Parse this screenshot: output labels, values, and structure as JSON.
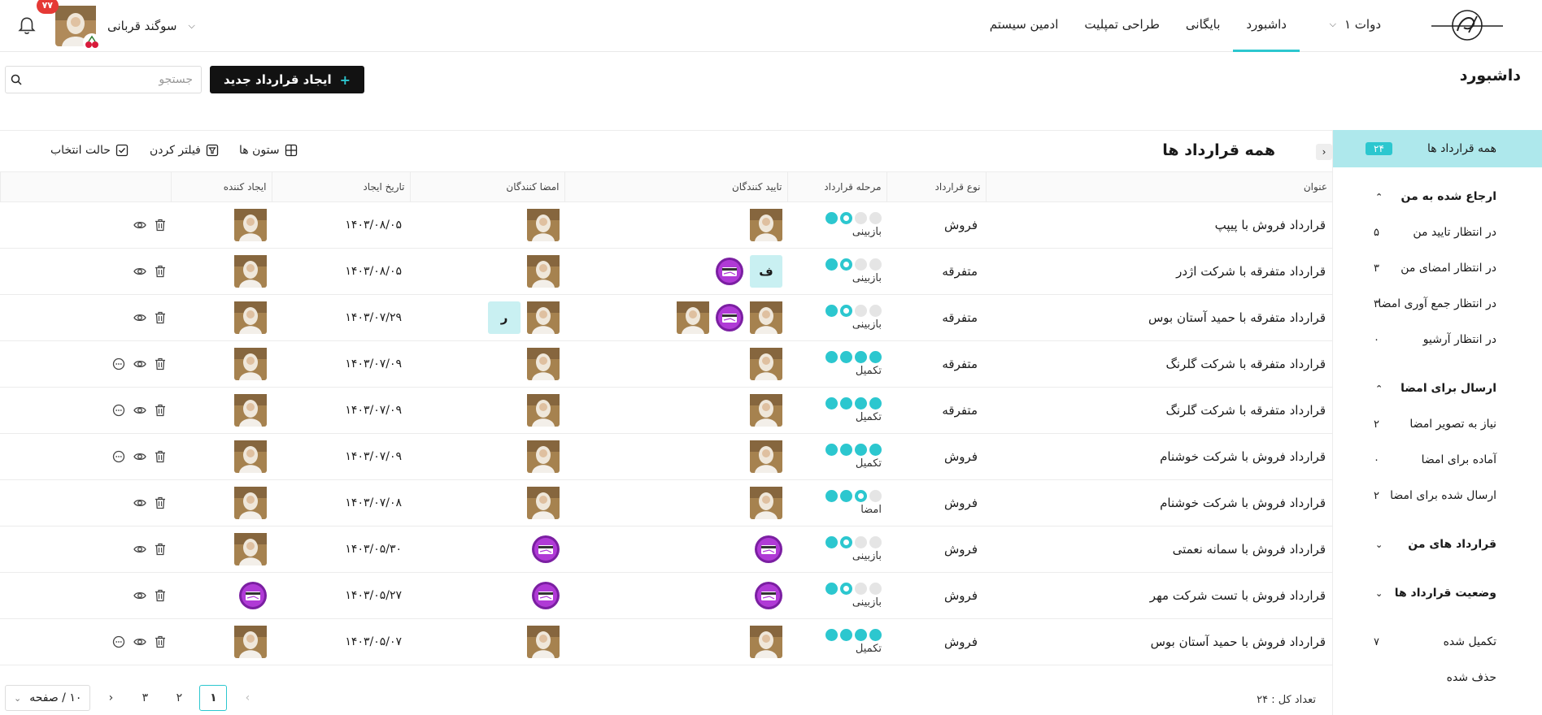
{
  "header": {
    "org": "دوات ۱",
    "nav": [
      "داشبورد",
      "بایگانی",
      "طراحی تمپلیت",
      "ادمین سیستم"
    ],
    "active_nav": 0,
    "user_name": "سوگند قربانی",
    "notifications": "۷۷"
  },
  "page": {
    "title": "داشبورد",
    "new_button": "ایجاد قرارداد جدید",
    "search_placeholder": "جستجو"
  },
  "sidebar": {
    "all": {
      "label": "همه قرارداد ها",
      "count": "۲۴"
    },
    "groups": [
      {
        "label": "ارجاع شده به من",
        "expanded": true,
        "items": [
          {
            "label": "در انتظار تایید من",
            "count": "۵"
          },
          {
            "label": "در انتظار امضای من",
            "count": "۳"
          },
          {
            "label": "در انتظار جمع آوری امضا",
            "count": "۳"
          },
          {
            "label": "در انتظار آرشیو",
            "count": "۰"
          }
        ]
      },
      {
        "label": "ارسال برای امضا",
        "expanded": true,
        "items": [
          {
            "label": "نیاز به تصویر امضا",
            "count": "۲"
          },
          {
            "label": "آماده برای امضا",
            "count": "۰"
          },
          {
            "label": "ارسال شده برای امضا",
            "count": "۲"
          }
        ]
      },
      {
        "label": "قرارداد های من",
        "expanded": false,
        "items": []
      },
      {
        "label": "وضعیت قرارداد ها",
        "expanded": false,
        "items": [
          {
            "label": "تکمیل شده",
            "count": "۷"
          },
          {
            "label": "حذف شده",
            "count": ""
          }
        ]
      }
    ]
  },
  "panel": {
    "title": "همه قرارداد ها",
    "tools": {
      "columns": "ستون ها",
      "filter": "فیلتر کردن",
      "select": "حالت انتخاب"
    },
    "columns": [
      "عنوان",
      "نوع قرارداد",
      "مرحله قرارداد",
      "تایید کنندگان",
      "امضا کنندگان",
      "تاریخ ایجاد",
      "ایجاد کننده"
    ]
  },
  "rows": [
    {
      "title": "قرارداد فروش با پیپپ",
      "type": "فروش",
      "stage": "بازبینی",
      "dots": [
        "on",
        "ring",
        "off",
        "off"
      ],
      "approvers": [
        "photo"
      ],
      "signers": [
        "photo"
      ],
      "date": "۱۴۰۳/۰۸/۰۵",
      "creator": "photo",
      "actions": [
        "eye",
        "trash"
      ]
    },
    {
      "title": "قرارداد متفرقه با شرکت اژدر",
      "type": "متفرقه",
      "stage": "بازبینی",
      "dots": [
        "on",
        "ring",
        "off",
        "off"
      ],
      "approvers": [
        "letter:ف",
        "logo"
      ],
      "signers": [
        "photo"
      ],
      "date": "۱۴۰۳/۰۸/۰۵",
      "creator": "photo",
      "actions": [
        "eye",
        "trash"
      ]
    },
    {
      "title": "قرارداد متفرقه با حمید آستان بوس",
      "type": "متفرقه",
      "stage": "بازبینی",
      "dots": [
        "on",
        "ring",
        "off",
        "off"
      ],
      "approvers": [
        "photo",
        "logo",
        "photo"
      ],
      "signers": [
        "photo",
        "letter:ر"
      ],
      "date": "۱۴۰۳/۰۷/۲۹",
      "creator": "photo",
      "actions": [
        "eye",
        "trash"
      ]
    },
    {
      "title": "قرارداد متفرقه با شرکت گلرنگ",
      "type": "متفرقه",
      "stage": "تکمیل",
      "dots": [
        "on",
        "on",
        "on",
        "on"
      ],
      "approvers": [
        "photo"
      ],
      "signers": [
        "photo"
      ],
      "date": "۱۴۰۳/۰۷/۰۹",
      "creator": "photo",
      "actions": [
        "more",
        "eye",
        "trash"
      ]
    },
    {
      "title": "قرارداد متفرقه با شرکت گلرنگ",
      "type": "متفرقه",
      "stage": "تکمیل",
      "dots": [
        "on",
        "on",
        "on",
        "on"
      ],
      "approvers": [
        "photo"
      ],
      "signers": [
        "photo"
      ],
      "date": "۱۴۰۳/۰۷/۰۹",
      "creator": "photo",
      "actions": [
        "more",
        "eye",
        "trash"
      ]
    },
    {
      "title": "قرارداد فروش با شرکت خوشنام",
      "type": "فروش",
      "stage": "تکمیل",
      "dots": [
        "on",
        "on",
        "on",
        "on"
      ],
      "approvers": [
        "photo"
      ],
      "signers": [
        "photo"
      ],
      "date": "۱۴۰۳/۰۷/۰۹",
      "creator": "photo",
      "actions": [
        "more",
        "eye",
        "trash"
      ]
    },
    {
      "title": "قرارداد فروش با شرکت خوشنام",
      "type": "فروش",
      "stage": "امضا",
      "dots": [
        "on",
        "on",
        "ring",
        "off"
      ],
      "approvers": [
        "photo"
      ],
      "signers": [
        "photo"
      ],
      "date": "۱۴۰۳/۰۷/۰۸",
      "creator": "photo",
      "actions": [
        "eye",
        "trash"
      ]
    },
    {
      "title": "قرارداد فروش با سمانه نعمتی",
      "type": "فروش",
      "stage": "بازبینی",
      "dots": [
        "on",
        "ring",
        "off",
        "off"
      ],
      "approvers": [
        "logo"
      ],
      "signers": [
        "logo"
      ],
      "date": "۱۴۰۳/۰۵/۳۰",
      "creator": "photo",
      "actions": [
        "eye",
        "trash"
      ]
    },
    {
      "title": "قرارداد فروش با تست شرکت مهر",
      "type": "فروش",
      "stage": "بازبینی",
      "dots": [
        "on",
        "ring",
        "off",
        "off"
      ],
      "approvers": [
        "logo"
      ],
      "signers": [
        "logo"
      ],
      "date": "۱۴۰۳/۰۵/۲۷",
      "creator": "logo",
      "actions": [
        "eye",
        "trash"
      ]
    },
    {
      "title": "قرارداد فروش با حمید آستان بوس",
      "type": "فروش",
      "stage": "تکمیل",
      "dots": [
        "on",
        "on",
        "on",
        "on"
      ],
      "approvers": [
        "photo"
      ],
      "signers": [
        "photo"
      ],
      "date": "۱۴۰۳/۰۵/۰۷",
      "creator": "photo",
      "actions": [
        "more",
        "eye",
        "trash"
      ]
    }
  ],
  "footer": {
    "total": "تعداد کل : ۲۴",
    "pages": [
      "۱",
      "۲",
      "۳"
    ],
    "current_page": 0,
    "page_size": "۱۰ / صفحه"
  },
  "colors": {
    "accent": "#2cc7cf",
    "accent_light": "#aee8ec",
    "badge": "#e53935",
    "dark": "#121212"
  }
}
